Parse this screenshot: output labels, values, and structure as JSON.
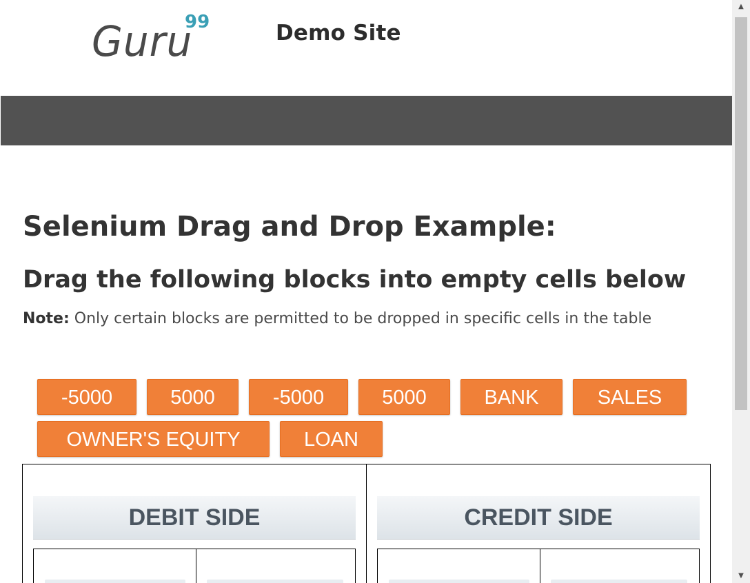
{
  "header": {
    "logo_text": "Guru",
    "logo_superscript": "99",
    "site_title": "Demo Site"
  },
  "main": {
    "heading": "Selenium Drag and Drop Example:",
    "subheading": "Drag the following blocks into empty cells below",
    "note_label": "Note:",
    "note_text": " Only certain blocks are permitted to be dropped in specific cells in the table"
  },
  "blocks": [
    {
      "label": "-5000"
    },
    {
      "label": "5000"
    },
    {
      "label": "-5000"
    },
    {
      "label": "5000"
    },
    {
      "label": "BANK"
    },
    {
      "label": "SALES"
    },
    {
      "label": "OWNER'S EQUITY"
    },
    {
      "label": "LOAN"
    }
  ],
  "ledger": {
    "debit_header": "DEBIT SIDE",
    "credit_header": "CREDIT SIDE"
  },
  "colors": {
    "block_bg": "#f08038",
    "navbar_bg": "#525252",
    "logo_accent": "#3a9fb5"
  },
  "icons": {
    "scroll_up": "triangle-up-icon",
    "scroll_down": "triangle-down-icon"
  }
}
